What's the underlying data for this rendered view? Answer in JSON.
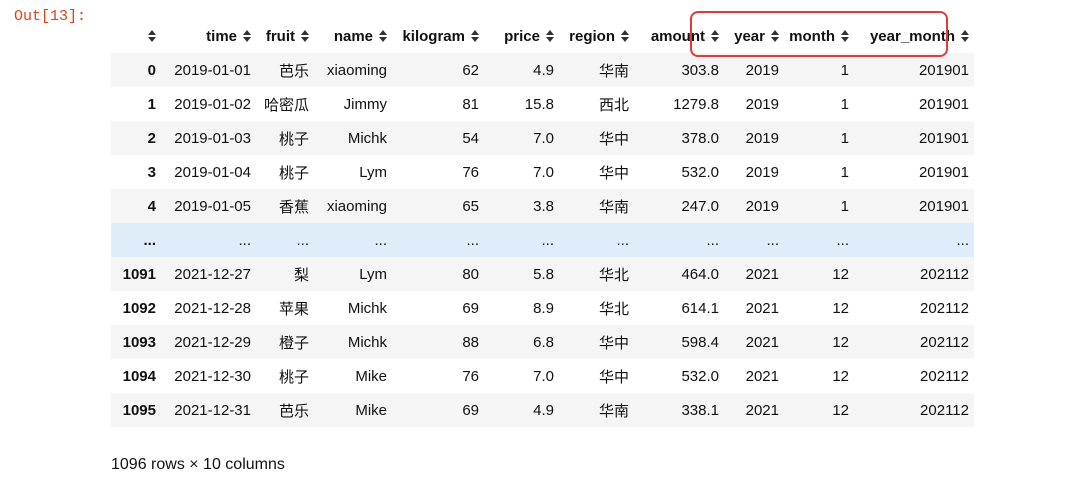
{
  "cell_prompt": "Out[13]:",
  "columns": [
    "",
    "time",
    "fruit",
    "name",
    "kilogram",
    "price",
    "region",
    "amount",
    "year",
    "month",
    "year_month"
  ],
  "rows": [
    {
      "index": "0",
      "time": "2019-01-01",
      "fruit": "芭乐",
      "name": "xiaoming",
      "kilogram": "62",
      "price": "4.9",
      "region": "华南",
      "amount": "303.8",
      "year": "2019",
      "month": "1",
      "year_month": "201901"
    },
    {
      "index": "1",
      "time": "2019-01-02",
      "fruit": "哈密瓜",
      "name": "Jimmy",
      "kilogram": "81",
      "price": "15.8",
      "region": "西北",
      "amount": "1279.8",
      "year": "2019",
      "month": "1",
      "year_month": "201901"
    },
    {
      "index": "2",
      "time": "2019-01-03",
      "fruit": "桃子",
      "name": "Michk",
      "kilogram": "54",
      "price": "7.0",
      "region": "华中",
      "amount": "378.0",
      "year": "2019",
      "month": "1",
      "year_month": "201901"
    },
    {
      "index": "3",
      "time": "2019-01-04",
      "fruit": "桃子",
      "name": "Lym",
      "kilogram": "76",
      "price": "7.0",
      "region": "华中",
      "amount": "532.0",
      "year": "2019",
      "month": "1",
      "year_month": "201901"
    },
    {
      "index": "4",
      "time": "2019-01-05",
      "fruit": "香蕉",
      "name": "xiaoming",
      "kilogram": "65",
      "price": "3.8",
      "region": "华南",
      "amount": "247.0",
      "year": "2019",
      "month": "1",
      "year_month": "201901"
    },
    {
      "index": "...",
      "time": "...",
      "fruit": "...",
      "name": "...",
      "kilogram": "...",
      "price": "...",
      "region": "...",
      "amount": "...",
      "year": "...",
      "month": "...",
      "year_month": "..."
    },
    {
      "index": "1091",
      "time": "2021-12-27",
      "fruit": "梨",
      "name": "Lym",
      "kilogram": "80",
      "price": "5.8",
      "region": "华北",
      "amount": "464.0",
      "year": "2021",
      "month": "12",
      "year_month": "202112"
    },
    {
      "index": "1092",
      "time": "2021-12-28",
      "fruit": "苹果",
      "name": "Michk",
      "kilogram": "69",
      "price": "8.9",
      "region": "华北",
      "amount": "614.1",
      "year": "2021",
      "month": "12",
      "year_month": "202112"
    },
    {
      "index": "1093",
      "time": "2021-12-29",
      "fruit": "橙子",
      "name": "Michk",
      "kilogram": "88",
      "price": "6.8",
      "region": "华中",
      "amount": "598.4",
      "year": "2021",
      "month": "12",
      "year_month": "202112"
    },
    {
      "index": "1094",
      "time": "2021-12-30",
      "fruit": "桃子",
      "name": "Mike",
      "kilogram": "76",
      "price": "7.0",
      "region": "华中",
      "amount": "532.0",
      "year": "2021",
      "month": "12",
      "year_month": "202112"
    },
    {
      "index": "1095",
      "time": "2021-12-31",
      "fruit": "芭乐",
      "name": "Mike",
      "kilogram": "69",
      "price": "4.9",
      "region": "华南",
      "amount": "338.1",
      "year": "2021",
      "month": "12",
      "year_month": "202112"
    }
  ],
  "summary": "1096 rows × 10 columns",
  "icons": {
    "sort": "sort-icon"
  },
  "colors": {
    "highlight": "#e53935",
    "prompt": "#d84315",
    "stripe": "#f5f5f5",
    "hover_row": "#dfedfb"
  }
}
